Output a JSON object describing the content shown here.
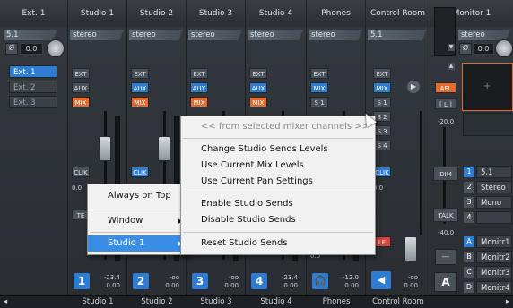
{
  "header": {
    "channels": [
      "Ext. 1",
      "Studio 1",
      "Studio 2",
      "Studio 3",
      "Studio 4",
      "Phones",
      "Control Room",
      "Monitor 1"
    ]
  },
  "formats": [
    "5.1",
    "stereo",
    "stereo",
    "stereo",
    "stereo",
    "stereo",
    "5.1",
    "stereo"
  ],
  "inputs": {
    "items": [
      "Ext. 1",
      "Ext. 2",
      "Ext. 3"
    ],
    "gain": "0.0"
  },
  "strips": [
    {
      "name": "Studio 1",
      "num": "1",
      "level": "-23.4",
      "value": "0.00",
      "btns": [
        "EXT",
        "AUX",
        "MIX"
      ],
      "clik": "CLIK",
      "talk": "TE",
      "small": "0.0"
    },
    {
      "name": "Studio 2",
      "num": "2",
      "level": "-oo",
      "value": "0.00",
      "btns": [
        "EXT",
        "AUX",
        "MIX"
      ],
      "clik": "CLIK"
    },
    {
      "name": "Studio 3",
      "num": "3",
      "level": "-oo",
      "value": "0.00",
      "btns": [
        "EXT",
        "AUX",
        "MIX"
      ]
    },
    {
      "name": "Studio 4",
      "num": "4",
      "level": "-23.4",
      "value": "0.00",
      "btns": [
        "EXT",
        "AUX",
        "MIX"
      ]
    },
    {
      "name": "Phones",
      "level": "-12.0",
      "value": "0.00",
      "btns": [
        "EXT",
        "MIX",
        "S 1"
      ],
      "small": "0.0"
    }
  ],
  "control_room": {
    "btns": [
      "EXT",
      "MIX",
      "S 1",
      "S 2",
      "S 3",
      "S 4"
    ],
    "clik": "CLIK",
    "small": "0.0",
    "le": "LE",
    "afl": "AFL",
    "lr": "[ L ]",
    "dim": "DIM",
    "talk": "TALK",
    "db1": "-20.0",
    "db2": "-40.0",
    "level": "-oo",
    "value": "0.00",
    "a_label": "A"
  },
  "monitor": {
    "items": [
      {
        "num": "1",
        "label": "5.1"
      },
      {
        "num": "2",
        "label": "Stereo"
      },
      {
        "num": "3",
        "label": "Mono"
      },
      {
        "num": "4",
        "label": ""
      }
    ],
    "outs": [
      {
        "num": "A",
        "label": "Monitr1"
      },
      {
        "num": "B",
        "label": "Monitr2"
      },
      {
        "num": "C",
        "label": "Monitr3"
      },
      {
        "num": "D",
        "label": "Monitr4"
      }
    ],
    "gain": "0.0"
  },
  "context_menu": {
    "items": [
      "Always on Top",
      "Window",
      "Studio 1"
    ]
  },
  "submenu": {
    "header": "<< from selected mixer channels >>",
    "group1": [
      "Change Studio Sends Levels",
      "Use Current Mix Levels",
      "Use Current Pan Settings"
    ],
    "group2": [
      "Enable Studio Sends",
      "Disable Studio Sends"
    ],
    "group3": [
      "Reset Studio Sends"
    ]
  },
  "footer": [
    "Studio 1",
    "Studio 2",
    "Studio 3",
    "Studio 4",
    "Phones",
    "Control Room"
  ],
  "colors": {
    "accent": "#2e7dd3",
    "orange": "#e86a2c",
    "red": "#d9443a"
  }
}
